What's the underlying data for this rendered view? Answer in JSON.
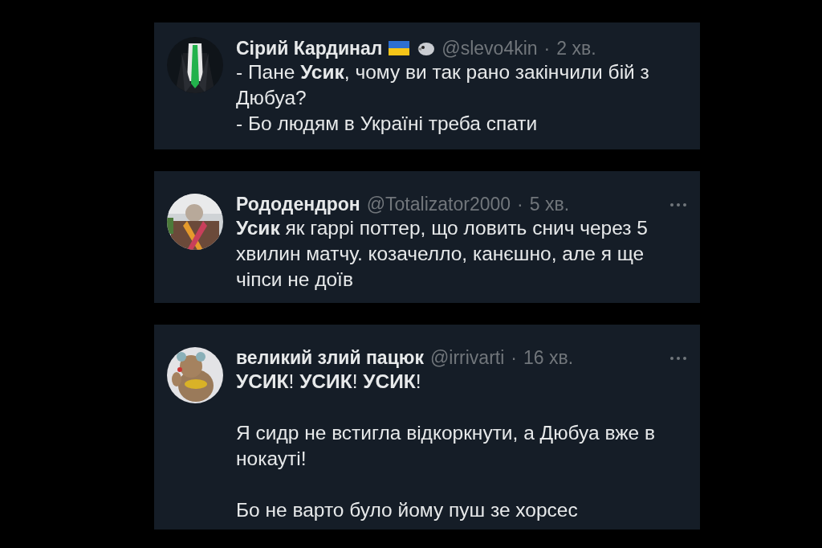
{
  "tweets": [
    {
      "name": "Сірий Кардинал",
      "badges": [
        {
          "kind": "flag"
        },
        {
          "kind": "bird"
        }
      ],
      "handle": "@slevo4kin",
      "separator": "·",
      "time": "2 хв.",
      "more_menu": false,
      "paragraphs": [
        "- Пане **Усик**, чому ви так рано закінчили бій з Дюбуа?\n- Бо людям в Україні треба спати"
      ]
    },
    {
      "name": "Рододендрон",
      "handle": "@Totalizator2000",
      "separator": "·",
      "time": "5 хв.",
      "more_menu": true,
      "paragraphs": [
        "**Усик** як гаррі поттер, що ловить снич через 5 хвилин матчу. козачелло, канєшно, але я ще чіпси не доїв"
      ]
    },
    {
      "name": "великий злий пацюк",
      "handle": "@irrivarti",
      "separator": "·",
      "time": "16 хв.",
      "more_menu": true,
      "paragraphs": [
        "**УСИК**! **УСИК**! **УСИК**!",
        "Я сидр не встигла відкоркнути, а Дюбуа вже в нокауті!",
        "Бо не варто було йому пуш зе хорсес"
      ]
    }
  ]
}
